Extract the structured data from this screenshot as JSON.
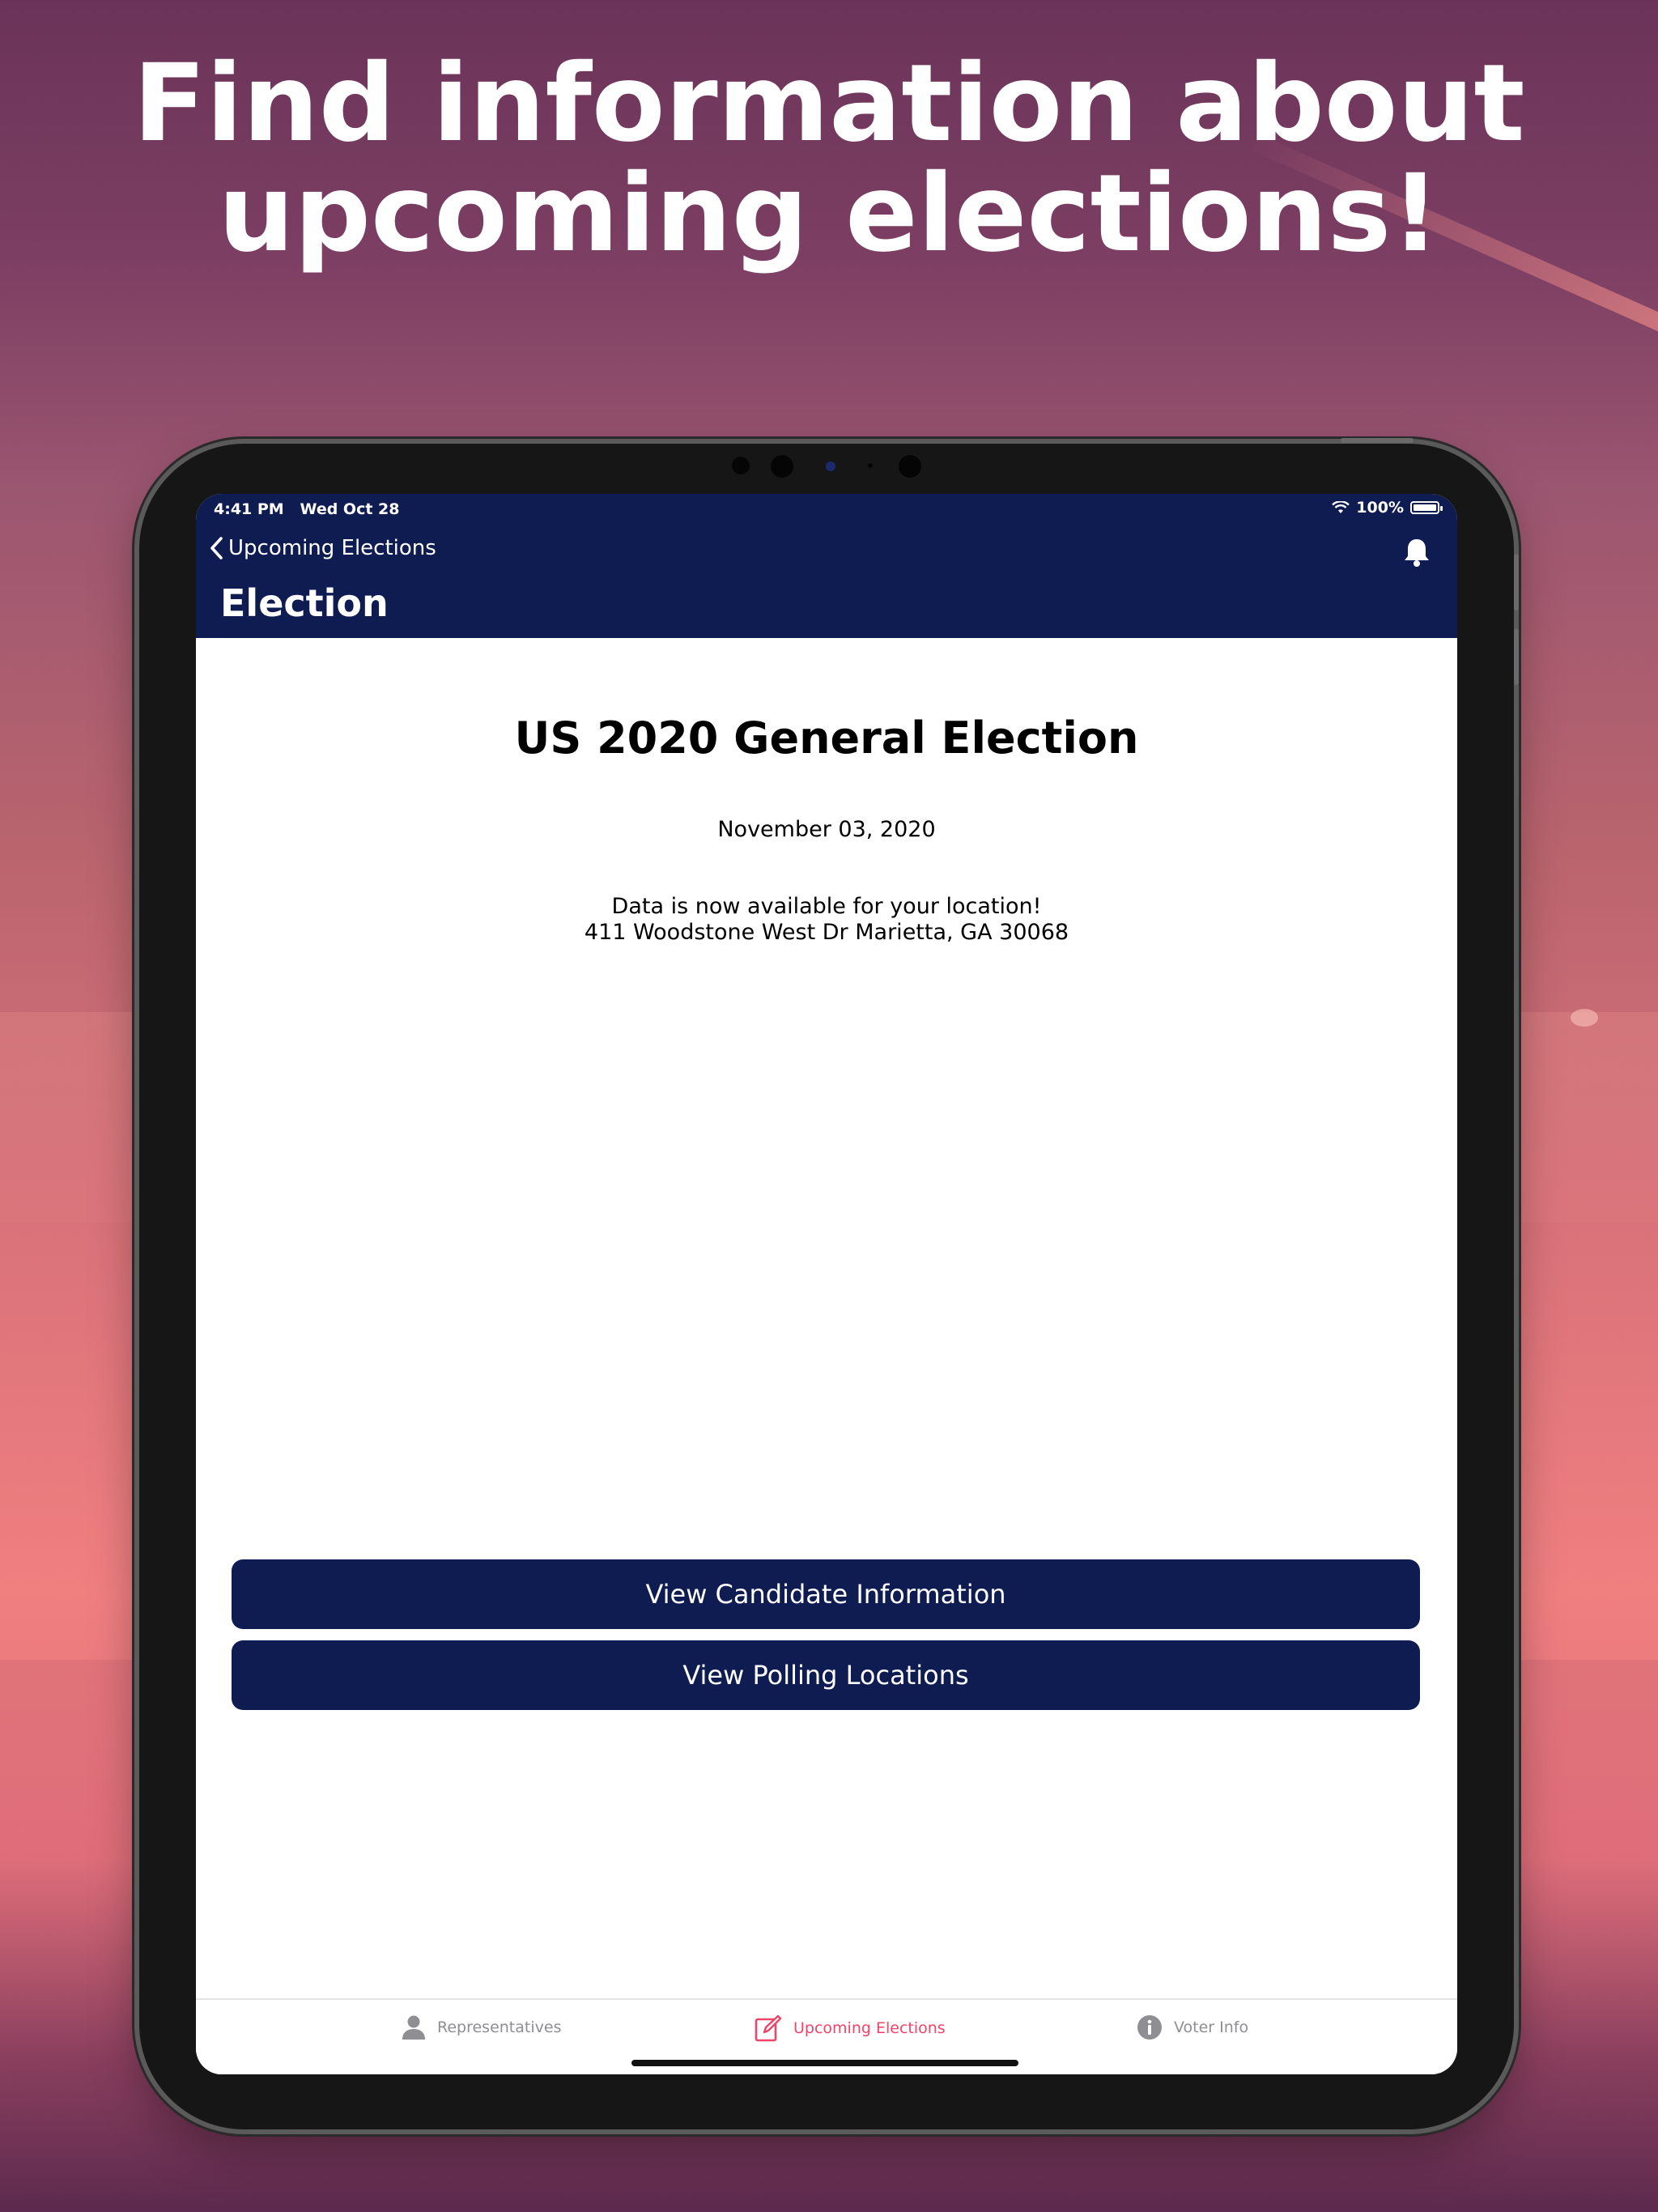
{
  "headline": {
    "line1": "Find information about",
    "line2": "upcoming elections!"
  },
  "status_bar": {
    "time_date": "4:41 PM   Wed Oct 28",
    "battery_percent": "100%"
  },
  "nav": {
    "back_label": "Upcoming Elections",
    "title": "Election"
  },
  "election": {
    "name": "US 2020 General Election",
    "date": "November 03, 2020",
    "availability_line1": "Data is now available for your location!",
    "availability_line2": "411 Woodstone West Dr Marietta, GA 30068"
  },
  "buttons": {
    "candidate_info": "View Candidate Information",
    "polling_locations": "View Polling Locations"
  },
  "tabs": [
    {
      "label": "Representatives",
      "icon": "person-icon",
      "active": false
    },
    {
      "label": "Upcoming Elections",
      "icon": "edit-icon",
      "active": true
    },
    {
      "label": "Voter Info",
      "icon": "info-icon",
      "active": false
    }
  ],
  "colors": {
    "nav_background": "#0f1c52",
    "button_background": "#0f1c52",
    "tab_active": "#f04468",
    "tab_inactive": "#8e8e93"
  }
}
